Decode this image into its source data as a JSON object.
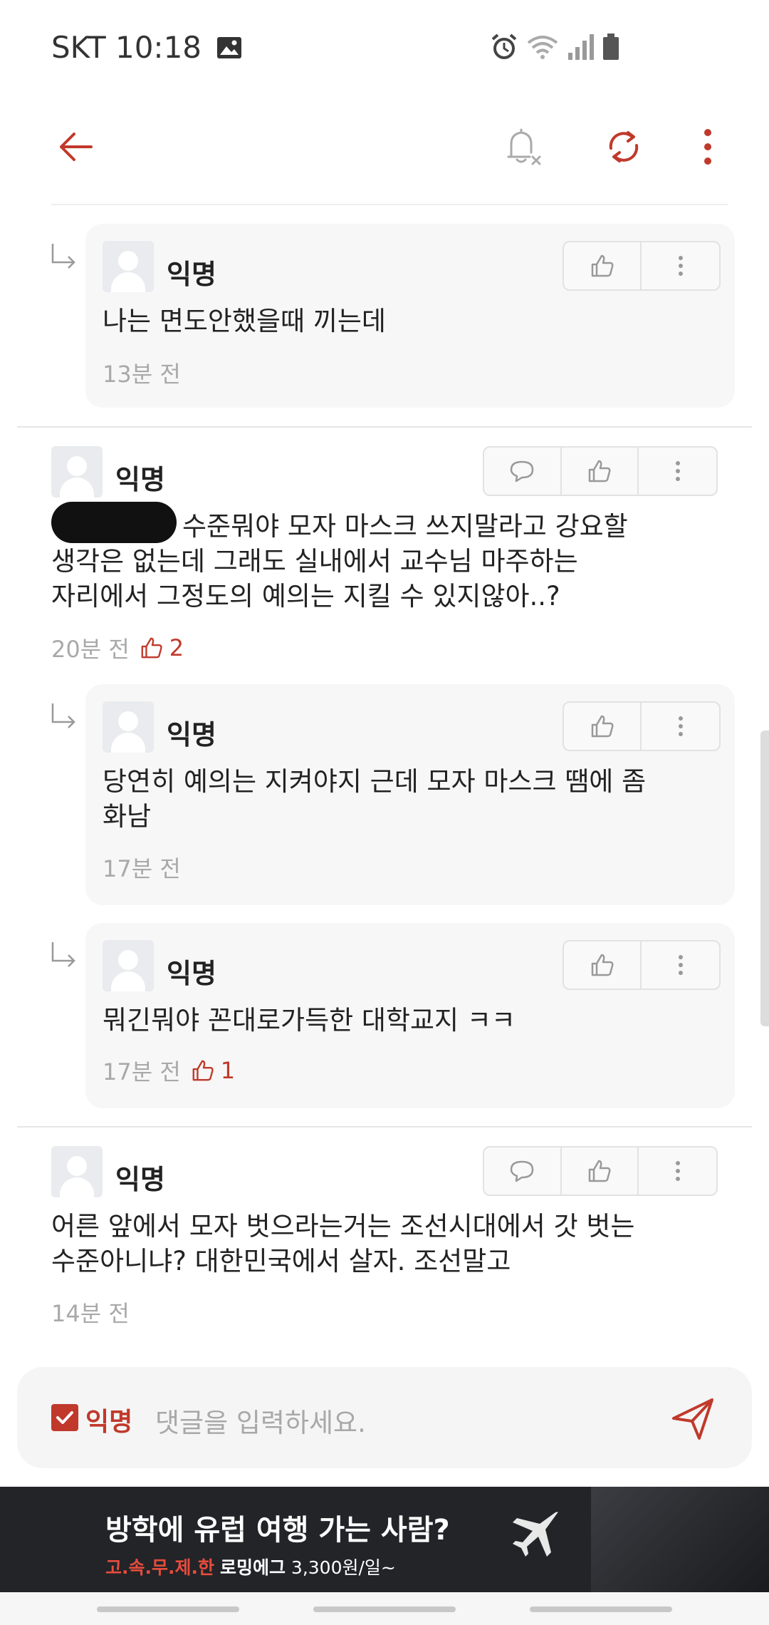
{
  "status_bar": {
    "carrier": "SKT",
    "time": "10:18"
  },
  "comments": [
    {
      "author": "익명",
      "text": "나는 면도안했을때 끼는데",
      "time": "13분 전",
      "likes": ""
    },
    {
      "author": "익명",
      "text_line1_suffix": "수준뭐야 모자 마스크 쓰지말라고 강요할",
      "text_line2": "생각은 없는데 그래도 실내에서 교수님 마주하는",
      "text_line3": "자리에서 그정도의 예의는 지킬 수 있지않아..?",
      "time": "20분 전",
      "likes": "2"
    },
    {
      "author": "익명",
      "text_line1": "당연히 예의는 지켜야지 근데 모자 마스크 땜에 좀",
      "text_line2": "화남",
      "time": "17분 전",
      "likes": ""
    },
    {
      "author": "익명",
      "text": "뭐긴뭐야 꼰대로가득한 대학교지 ㅋㅋ",
      "time": "17분 전",
      "likes": "1"
    },
    {
      "author": "익명",
      "text_line1": "어른 앞에서 모자 벗으라는거는 조선시대에서 갓 벗는",
      "text_line2": "수준아니냐? 대한민국에서 살자. 조선말고",
      "time": "14분 전",
      "likes": ""
    }
  ],
  "input": {
    "anon_label": "익명",
    "placeholder": "댓글을 입력하세요."
  },
  "ad": {
    "title": "방학에 유럽 여행 가는 사람?",
    "sub_red": "고.속.무.제.한",
    "sub_brand": "로밍에그",
    "sub_price": "3,300원/일~"
  },
  "colors": {
    "accent": "#c0392b",
    "muted": "#a9a9a9"
  },
  "icons": [
    "back-arrow-icon",
    "notification-off-icon",
    "refresh-icon",
    "more-vertical-icon",
    "comment-icon",
    "thumbs-up-icon",
    "reply-arrow-icon",
    "send-icon"
  ]
}
